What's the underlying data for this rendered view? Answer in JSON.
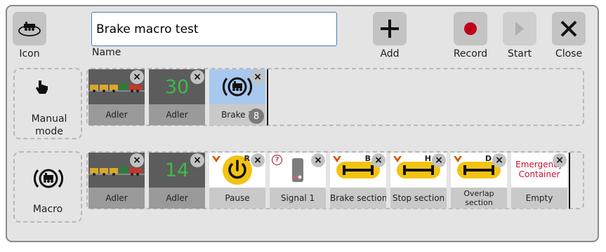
{
  "toolbar": {
    "icon_label": "Icon",
    "name_label": "Name",
    "name_value": "Brake macro test",
    "add_label": "Add",
    "record_label": "Record",
    "start_label": "Start",
    "close_label": "Close"
  },
  "manual": {
    "label": "Manual mode",
    "tiles": [
      {
        "type": "loco-image",
        "label": "Adler"
      },
      {
        "type": "speed",
        "value": "30",
        "label": "Adler"
      },
      {
        "type": "brake",
        "label": "Brake 1",
        "badge": "8"
      }
    ]
  },
  "macro": {
    "label": "Macro",
    "tiles": [
      {
        "type": "loco-image",
        "label": "Adler"
      },
      {
        "type": "speed",
        "value": "14",
        "label": "Adler"
      },
      {
        "type": "pause",
        "label": "Pause",
        "tag": "R"
      },
      {
        "type": "signal",
        "label": "Signal 1"
      },
      {
        "type": "section",
        "label": "Brake section",
        "tag": "B"
      },
      {
        "type": "section",
        "label": "Stop section",
        "tag": "H"
      },
      {
        "type": "section",
        "label": "Overlap section",
        "tag": "D"
      },
      {
        "type": "container",
        "title": "Emergency Container",
        "label": "Empty"
      }
    ]
  },
  "colors": {
    "accent_yellow": "#f3c313",
    "record_red": "#c0001a",
    "speed_green": "#3cbc45",
    "container_red": "#c8102e",
    "brake_blue": "#a9c8ee"
  },
  "icons": {
    "close": "×",
    "signal_question": "?"
  }
}
